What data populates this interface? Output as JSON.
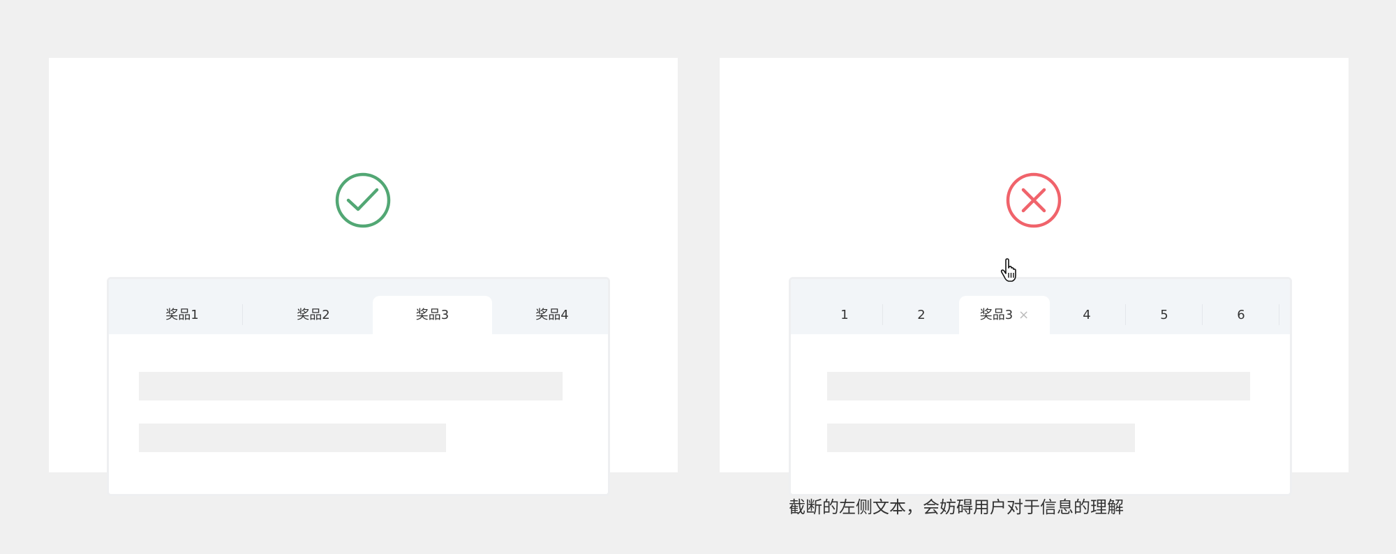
{
  "good_example": {
    "status_icon": "check-circle-icon",
    "color": "#52a774",
    "tabs": [
      "奖品1",
      "奖品2",
      "奖品3",
      "奖品4"
    ],
    "active_tab": 2
  },
  "bad_example": {
    "status_icon": "x-circle-icon",
    "color": "#f0636b",
    "tabs": [
      "1",
      "2",
      "奖品3",
      "4",
      "5",
      "6"
    ],
    "active_tab": 2,
    "close_icon": "×",
    "caption": "截断的左侧文本，会妨碍用户对于信息的理解"
  }
}
